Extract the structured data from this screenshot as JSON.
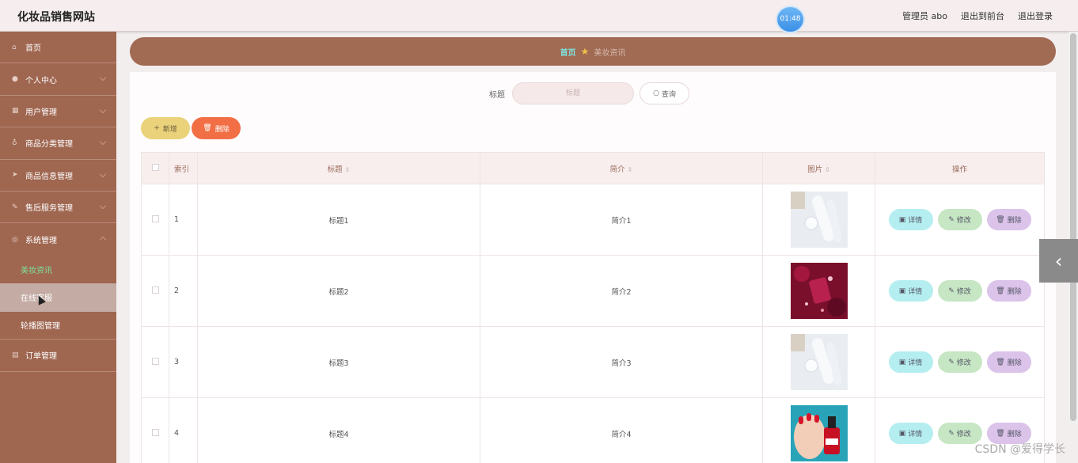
{
  "header": {
    "site_title": "化妆品销售网站",
    "clock": "01:48",
    "role_label": "管理员 abo",
    "to_front": "退出到前台",
    "logout": "退出登录"
  },
  "sidebar": {
    "items": [
      {
        "label": "首页",
        "icon": "home-icon"
      },
      {
        "label": "个人中心",
        "icon": "user-icon"
      },
      {
        "label": "用户管理",
        "icon": "grid-icon"
      },
      {
        "label": "商品分类管理",
        "icon": "mic-icon"
      },
      {
        "label": "商品信息管理",
        "icon": "send-icon"
      },
      {
        "label": "售后服务管理",
        "icon": "edit-icon"
      },
      {
        "label": "系统管理",
        "icon": "settings-icon"
      }
    ],
    "system_sub": [
      "美妆资讯",
      "在线客服",
      "轮播图管理"
    ],
    "order_item": {
      "label": "订单管理",
      "icon": "table-icon"
    }
  },
  "breadcrumb": {
    "home": "首页",
    "current": "美妆资讯"
  },
  "search": {
    "label": "标题",
    "placeholder": "标题",
    "button": "查询"
  },
  "actions": {
    "add": "新增",
    "delete": "删除"
  },
  "table": {
    "headers": {
      "index": "索引",
      "title": "标题",
      "intro": "简介",
      "image": "图片",
      "ops": "操作"
    },
    "ops_labels": {
      "detail": "详情",
      "edit": "修改",
      "remove": "删除"
    },
    "rows": [
      {
        "index": "1",
        "title": "标题1",
        "intro": "简介1",
        "image": "skincare-bottle-photo"
      },
      {
        "index": "2",
        "title": "标题2",
        "intro": "简介2",
        "image": "red-cosmetics-photo"
      },
      {
        "index": "3",
        "title": "标题3",
        "intro": "简介3",
        "image": "skincare-bottle-photo"
      },
      {
        "index": "4",
        "title": "标题4",
        "intro": "简介4",
        "image": "red-nail-polish-photo"
      }
    ]
  },
  "watermark": "CSDN @爱得学长",
  "colors": {
    "sidebar": "#9f6650",
    "breadcrumb": "#a06a53",
    "add_button": "#e9d27a",
    "delete_button": "#f26f45",
    "detail_button": "#b5eef0",
    "edit_button": "#c6e6c4",
    "remove_button": "#dbc3ea"
  }
}
